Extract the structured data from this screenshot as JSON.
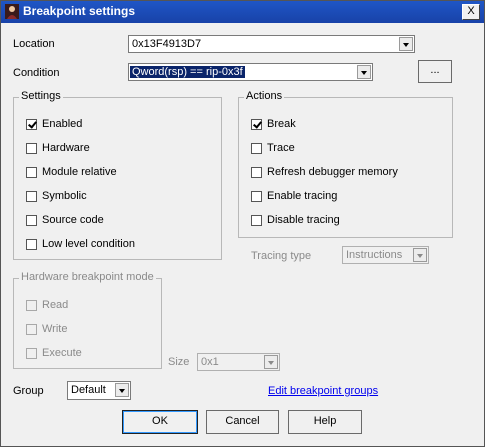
{
  "window": {
    "title": "Breakpoint settings",
    "close_glyph": "X"
  },
  "location": {
    "label": "Location",
    "value": "0x13F4913D7"
  },
  "condition": {
    "label": "Condition",
    "value": "Qword(rsp) == rip-0x3f",
    "browse_label": "..."
  },
  "settings": {
    "title": "Settings",
    "items": [
      {
        "label": "Enabled",
        "checked": true
      },
      {
        "label": "Hardware",
        "checked": false
      },
      {
        "label": "Module relative",
        "checked": false
      },
      {
        "label": "Symbolic",
        "checked": false
      },
      {
        "label": "Source code",
        "checked": false
      },
      {
        "label": "Low level condition",
        "checked": false
      }
    ]
  },
  "actions": {
    "title": "Actions",
    "items": [
      {
        "label": "Break",
        "checked": true
      },
      {
        "label": "Trace",
        "checked": false
      },
      {
        "label": "Refresh debugger memory",
        "checked": false
      },
      {
        "label": "Enable tracing",
        "checked": false
      },
      {
        "label": "Disable tracing",
        "checked": false
      }
    ]
  },
  "tracing": {
    "label": "Tracing type",
    "value": "Instructions"
  },
  "hardware": {
    "title": "Hardware breakpoint mode",
    "items": [
      {
        "label": "Read",
        "checked": false
      },
      {
        "label": "Write",
        "checked": false
      },
      {
        "label": "Execute",
        "checked": false
      }
    ]
  },
  "size": {
    "label": "Size",
    "value": "0x1"
  },
  "group": {
    "label": "Group",
    "value": "Default"
  },
  "edit_groups_link": "Edit breakpoint groups",
  "buttons": {
    "ok": "OK",
    "cancel": "Cancel",
    "help": "Help"
  }
}
